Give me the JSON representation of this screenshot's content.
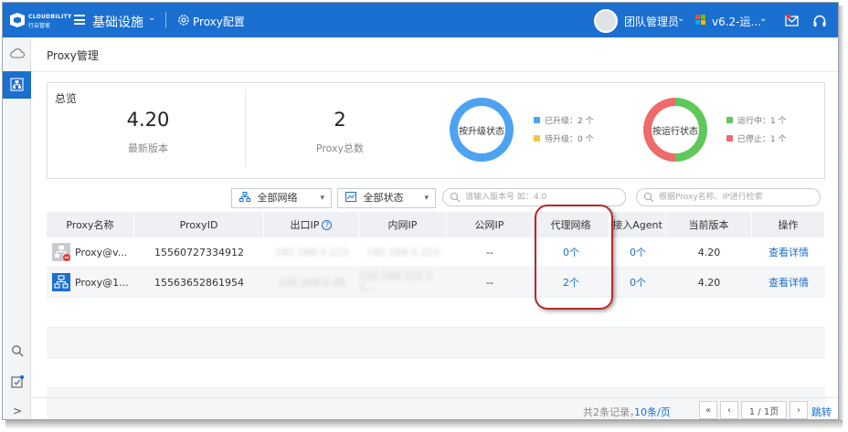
{
  "header": {
    "logo_text": "CLOUDBILITY",
    "logo_sub": "行云管家",
    "nav_title": "基础设施",
    "nav_caret": "⌄",
    "proxy_tab": "Proxy配置",
    "user": "团队管理员",
    "version": "v6.2-运...",
    "caret": "⌄"
  },
  "page": {
    "title": "Proxy管理"
  },
  "overview": {
    "label": "总览",
    "latest_version": "4.20",
    "latest_version_label": "最新版本",
    "proxy_total": "2",
    "proxy_total_label": "Proxy总数",
    "upgrade_ring_label": "按升级状态",
    "run_ring_label": "按运行状态",
    "upgrade_legend": [
      {
        "text": "已升级：2 个",
        "color": "#4da3ef"
      },
      {
        "text": "待升级：0 个",
        "color": "#f5c24a"
      }
    ],
    "run_legend": [
      {
        "text": "运行中：1 个",
        "color": "#5ec85a"
      },
      {
        "text": "已停止：1 个",
        "color": "#ef6a6a"
      }
    ],
    "upgrade_share": [
      2,
      0
    ],
    "run_share": [
      1,
      1
    ]
  },
  "filters": {
    "network": "全部网络",
    "status": "全部状态",
    "version_placeholder": "请输入版本号 如：4.0",
    "search_placeholder": "根据Proxy名称、IP进行检索"
  },
  "table": {
    "columns": [
      "Proxy名称",
      "ProxyID",
      "出口IP",
      "内网IP",
      "公网IP",
      "代理网络",
      "接入Agent",
      "当前版本",
      "操作"
    ],
    "rows": [
      {
        "name": "Proxy@v...",
        "id": "15560727334912",
        "exit_ip": "192.168.0.223",
        "lan_ip": "192.168.0.223",
        "wan_ip": "--",
        "proxy_net": "0个",
        "agents": "0个",
        "version": "4.20",
        "action": "查看详情",
        "status": "stopped"
      },
      {
        "name": "Proxy@1...",
        "id": "15563652861954",
        "exit_ip": "192.168.0.49",
        "lan_ip": "192.168.122.1 1...",
        "wan_ip": "--",
        "proxy_net": "2个",
        "agents": "0个",
        "version": "4.20",
        "action": "查看详情",
        "status": "running"
      }
    ]
  },
  "pager": {
    "total": "共2条记录，",
    "page_size": "10条/页",
    "first": "«",
    "prev": "‹",
    "page": "1 / 1页",
    "next": "›",
    "last": "»",
    "jump": "跳转"
  },
  "icons": {
    "help": "?",
    "expand": ">"
  },
  "colors": {
    "brand": "#1a6fd0",
    "highlight": "#b52a2a"
  }
}
